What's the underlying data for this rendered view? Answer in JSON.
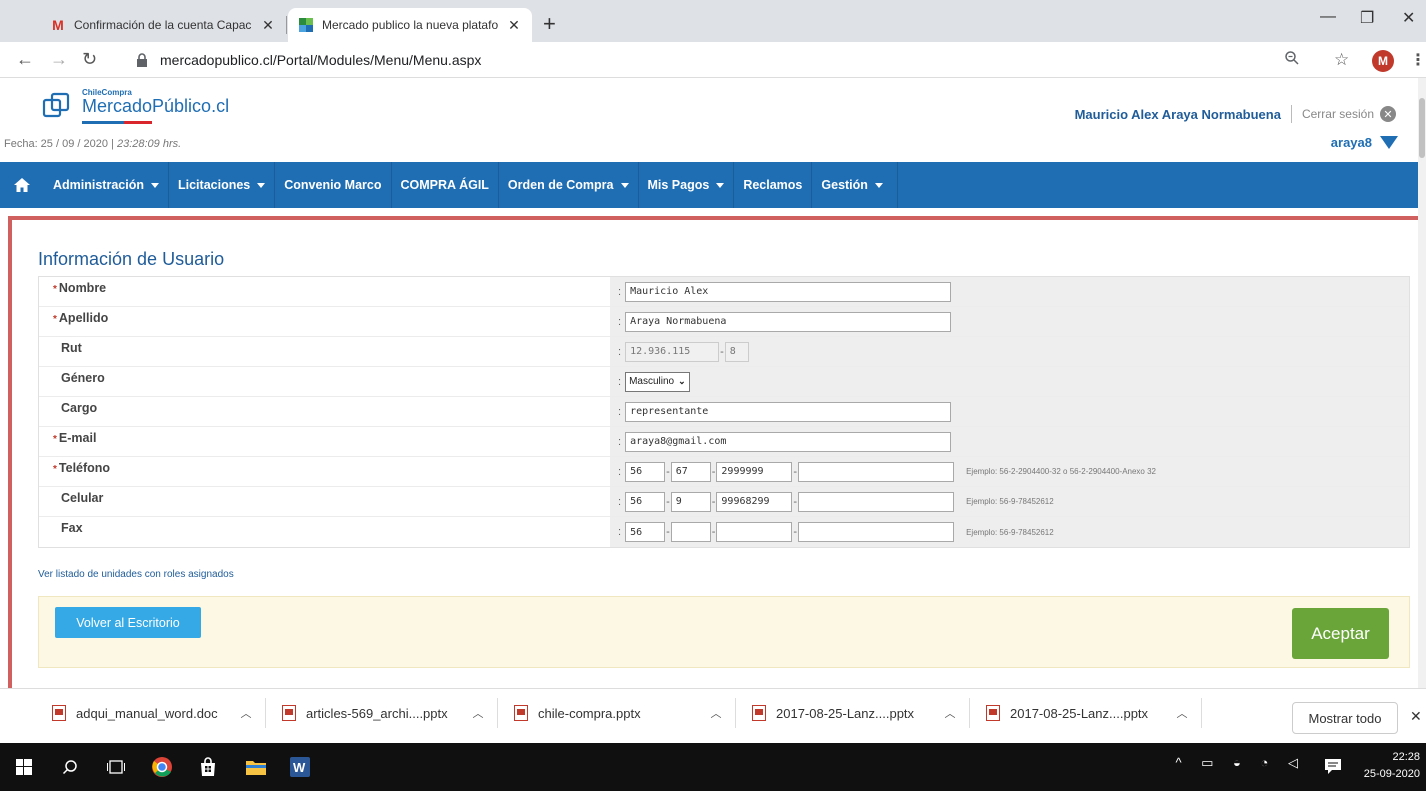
{
  "browser": {
    "tabs": [
      {
        "title": "Confirmación de la cuenta Capac",
        "favicon": "gmail-icon",
        "active": false
      },
      {
        "title": "Mercado publico la nueva platafo",
        "favicon": "mercadopublico-icon",
        "active": true
      }
    ],
    "url": "mercadopublico.cl/Portal/Modules/Menu/Menu.aspx",
    "profile_initial": "M"
  },
  "header": {
    "logo_small": "ChileCompra",
    "logo_big": "MercadoPúblico.cl",
    "date_label": "Fecha: 25 / 09 / 2020 |",
    "time_label": "23:28:09 hrs.",
    "user_name": "Mauricio Alex Araya Normabuena",
    "logout_label": "Cerrar sesión",
    "username": "araya8"
  },
  "nav": {
    "items": [
      {
        "label": "Administración",
        "dropdown": true
      },
      {
        "label": "Licitaciones",
        "dropdown": true
      },
      {
        "label": "Convenio Marco",
        "dropdown": false
      },
      {
        "label": "COMPRA ÁGIL",
        "dropdown": false
      },
      {
        "label": "Orden de Compra",
        "dropdown": true
      },
      {
        "label": "Mis Pagos",
        "dropdown": true
      },
      {
        "label": "Reclamos",
        "dropdown": false
      },
      {
        "label": "Gestión",
        "dropdown": true
      }
    ]
  },
  "form": {
    "title": "Información de Usuario",
    "required_mark": "*",
    "colon": ":",
    "dash": "-",
    "fields": {
      "nombre": {
        "label": "Nombre",
        "value": "Mauricio Alex"
      },
      "apellido": {
        "label": "Apellido",
        "value": "Araya Normabuena"
      },
      "rut": {
        "label": "Rut",
        "number": "12.936.115",
        "dv": "8"
      },
      "genero": {
        "label": "Género",
        "value": "Masculino"
      },
      "cargo": {
        "label": "Cargo",
        "value": "representante"
      },
      "email": {
        "label": "E-mail",
        "value": "araya8@gmail.com"
      },
      "telefono": {
        "label": "Teléfono",
        "country": "56",
        "area": "67",
        "number": "2999999",
        "ext": "",
        "example": "Ejemplo: 56-2-2904400-32 o 56-2-2904400-Anexo 32"
      },
      "celular": {
        "label": "Celular",
        "country": "56",
        "area": "9",
        "number": "99968299",
        "ext": "",
        "example": "Ejemplo: 56-9-78452612"
      },
      "fax": {
        "label": "Fax",
        "country": "56",
        "area": "",
        "number": "",
        "ext": "",
        "example": "Ejemplo: 56-9-78452612"
      }
    },
    "roles_link": "Ver listado de unidades con roles asignados",
    "back_button": "Volver al Escritorio",
    "accept_button": "Aceptar"
  },
  "downloads": {
    "items": [
      "adqui_manual_word.doc",
      "articles-569_archi....pptx",
      "chile-compra.pptx",
      "2017-08-25-Lanz....pptx",
      "2017-08-25-Lanz....pptx"
    ],
    "show_all": "Mostrar todo"
  },
  "taskbar": {
    "time": "22:28",
    "date": "25-09-2020"
  },
  "colors": {
    "nav_blue": "#1f6eb4",
    "accept_green": "#6aa53a",
    "back_blue": "#35a9e6",
    "highlight_red": "#d06060"
  }
}
